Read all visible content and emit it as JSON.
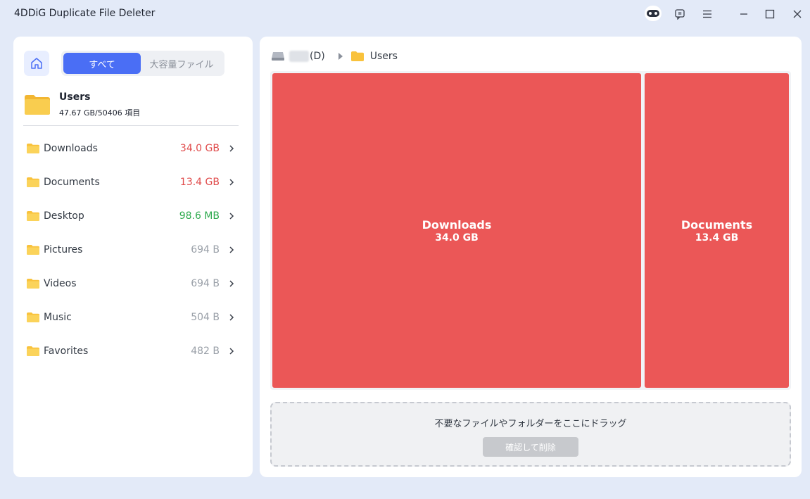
{
  "app": {
    "title": "4DDiG Duplicate File Deleter"
  },
  "left": {
    "tabs": [
      {
        "label": "すべて",
        "active": true
      },
      {
        "label": "大容量ファイル",
        "active": false
      }
    ],
    "root": {
      "name": "Users",
      "meta": "47.67 GB/50406 項目"
    },
    "folders": [
      {
        "name": "Downloads",
        "size": "34.0 GB",
        "color": "#e04b4b"
      },
      {
        "name": "Documents",
        "size": "13.4 GB",
        "color": "#e04b4b"
      },
      {
        "name": "Desktop",
        "size": "98.6 MB",
        "color": "#2eaa4e"
      },
      {
        "name": "Pictures",
        "size": "694 B",
        "color": "#9aa0a8"
      },
      {
        "name": "Videos",
        "size": "694 B",
        "color": "#9aa0a8"
      },
      {
        "name": "Music",
        "size": "504 B",
        "color": "#9aa0a8"
      },
      {
        "name": "Favorites",
        "size": "482 B",
        "color": "#9aa0a8"
      }
    ]
  },
  "right": {
    "breadcrumb": {
      "drive": "(D)",
      "folder": "Users"
    },
    "treemap": [
      {
        "name": "Downloads",
        "size": "34.0 GB"
      },
      {
        "name": "Documents",
        "size": "13.4 GB"
      }
    ],
    "dropzone": {
      "text": "不要なファイルやフォルダーをここにドラッグ",
      "button": "確認して削除"
    }
  },
  "colors": {
    "accent": "#4a6ef5",
    "tile": "#eb5757",
    "folder": "#f7c641"
  }
}
